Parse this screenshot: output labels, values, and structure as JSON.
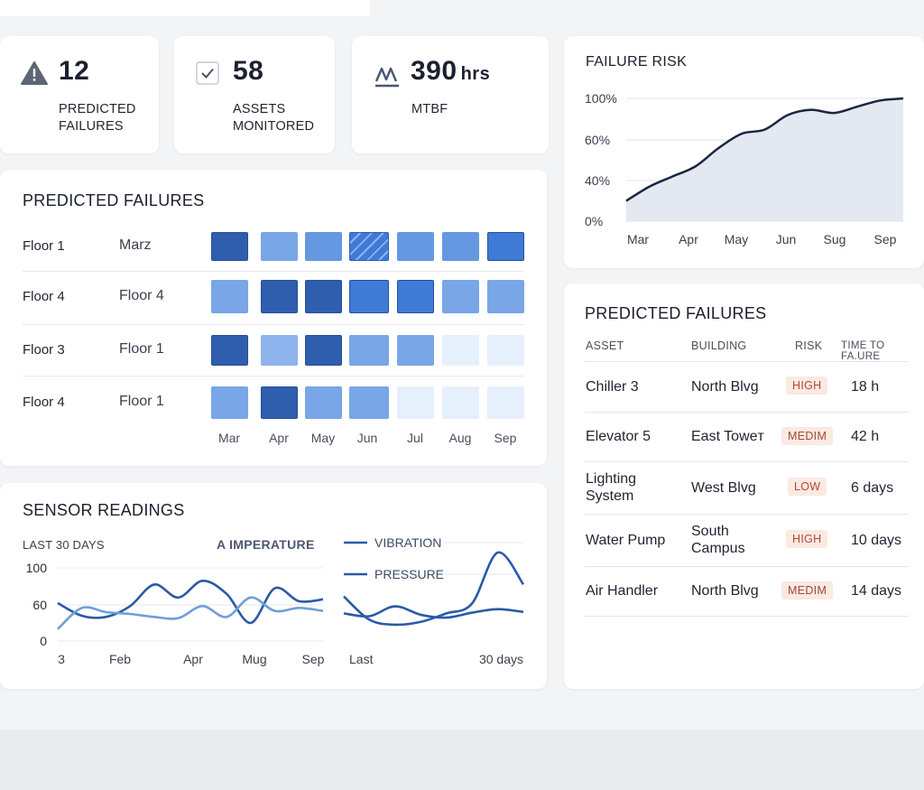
{
  "kpis": [
    {
      "icon": "warning-triangle-icon",
      "value": "12",
      "unit": "",
      "label": "PREDICTED\nFAILURES"
    },
    {
      "icon": "checkbox-icon",
      "value": "58",
      "unit": "",
      "label": "ASSETS\nMONITORED"
    },
    {
      "icon": "wave-icon",
      "value": "390",
      "unit": "hrs",
      "label": "MTBF"
    }
  ],
  "heatmap": {
    "title": "PREDICTED FAILURES",
    "months": [
      "Mar",
      "Apr",
      "May",
      "Jun",
      "Jul",
      "Aug",
      "Sep"
    ],
    "rows": [
      {
        "label": "Floor 1",
        "sub": "Marz",
        "levels": [
          5,
          2,
          3,
          "hatched",
          3,
          3,
          4
        ]
      },
      {
        "label": "Floor 4",
        "sub": "Floor 4",
        "levels": [
          2,
          5,
          5,
          4,
          4,
          2,
          2
        ]
      },
      {
        "label": "Floor 3",
        "sub": "Floor 1",
        "levels": [
          5,
          1,
          5,
          2,
          2,
          0,
          0
        ]
      },
      {
        "label": "Floor 4",
        "sub": "Floor 1",
        "levels": [
          2,
          5,
          2,
          2,
          0,
          0,
          0
        ]
      }
    ],
    "colors": [
      "#e6effc",
      "#8eb3ec",
      "#79a6e6",
      "#6598e0",
      "#3f7ad6",
      "#2f5eaf"
    ]
  },
  "risk_chart": {
    "title": "FAILURE RISK",
    "chart_data": {
      "type": "area",
      "title": "FAILURE RISK",
      "x_ticks": [
        "Mar",
        "Apr",
        "May",
        "Jun",
        "Sug",
        "Sep"
      ],
      "y_ticks": [
        "0%",
        "40%",
        "60%",
        "100%"
      ],
      "ylim": [
        0,
        100
      ],
      "grid": true,
      "series": [
        {
          "values": [
            20,
            34,
            42,
            47,
            56,
            66,
            70,
            84,
            89,
            86,
            92,
            98,
            100
          ]
        }
      ]
    },
    "line_color": "#1c2540",
    "fill_color": "#dfe5ef"
  },
  "table": {
    "title": "PREDICTED FAILURES",
    "headers": [
      "ASSET",
      "BUILDING",
      "RISK",
      "TIME TO FA.URE"
    ],
    "rows": [
      {
        "asset": "Chiller 3",
        "building": "North Blvg",
        "risk": "HIGH",
        "time": "18 h"
      },
      {
        "asset": "Elevator 5",
        "building": "East Toweт",
        "risk": "MEDIM",
        "time": "42 h"
      },
      {
        "asset": "Lighting\nSystem",
        "building": "West Blvg",
        "risk": "LOW",
        "time": "6 days"
      },
      {
        "asset": "Water Pump",
        "building": "South\nCampus",
        "risk": "HIGH",
        "time": "10 days"
      },
      {
        "asset": "Air Handler",
        "building": "North Blvg",
        "risk": "MEDIM",
        "time": "14 days"
      }
    ],
    "badge_colors": {
      "HIGH": "#fbe9e2",
      "MEDIM": "#fbe9e2",
      "LOW": "#fbe9e2"
    },
    "badge_text_colors": {
      "HIGH": "#b24a33",
      "MEDIM": "#9a4b36",
      "LOW": "#b24a33"
    }
  },
  "sensor": {
    "title": "SENSOR READINGS",
    "range_label": "LAST 30 DAYS",
    "temp_label": "A IMPERATURE",
    "vibration_label": "VIBRATION",
    "pressure_label": "PRESSURE",
    "left_chart": {
      "type": "line",
      "y_ticks": [
        "100",
        "60",
        "0"
      ],
      "x_ticks": [
        "3",
        "Feb",
        "Apr",
        "Mug",
        "Sep"
      ],
      "ylim": [
        0,
        100
      ],
      "series": [
        {
          "color": "#2a5aa6",
          "values": [
            62,
            42,
            40,
            58,
            82,
            68,
            86,
            72,
            30,
            78,
            64,
            66
          ]
        },
        {
          "color": "#6e9fd6",
          "values": [
            20,
            55,
            48,
            45,
            40,
            38,
            58,
            40,
            68,
            50,
            55,
            50
          ]
        }
      ]
    },
    "right_chart": {
      "type": "line",
      "x_ticks": [
        "Last",
        "30 days"
      ],
      "series": [
        {
          "name": "VIBRATION",
          "color": "#2a5aa6",
          "values": [
            58,
            25,
            18,
            22,
            34,
            48,
            120,
            75
          ]
        },
        {
          "name": "PRESSURE",
          "color": "#2a5aa6",
          "values": [
            34,
            30,
            44,
            32,
            28,
            35,
            40,
            36
          ]
        }
      ]
    }
  }
}
